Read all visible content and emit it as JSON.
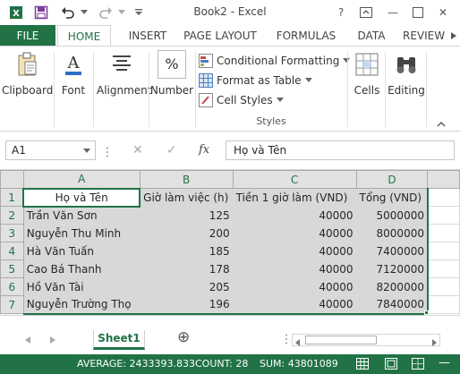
{
  "window": {
    "title": "Book2 - Excel",
    "help": "?",
    "minimize": "—",
    "close": "✕"
  },
  "tabs": [
    "FILE",
    "HOME",
    "INSERT",
    "PAGE LAYOUT",
    "FORMULAS",
    "DATA",
    "REVIEW"
  ],
  "ribbon": {
    "clipboard": "Clipboard",
    "font": "Font",
    "alignment": "Alignment",
    "number": "Number",
    "conditional": "Conditional Formatting",
    "format_table": "Format as Table",
    "cell_styles": "Cell Styles",
    "styles_group": "Styles",
    "cells": "Cells",
    "editing": "Editing",
    "number_symbol": "%"
  },
  "formula_bar": {
    "name_box": "A1",
    "fx": "fx",
    "cancel": "✕",
    "enter": "✓",
    "content": "Họ và Tên"
  },
  "columns": [
    "A",
    "B",
    "C",
    "D"
  ],
  "rows": [
    {
      "num": "1",
      "a": "Họ và Tên",
      "b": "Giờ làm việc (h)",
      "c": "Tiền 1 giờ làm (VND)",
      "d": "Tổng (VND)"
    },
    {
      "num": "2",
      "a": "Trần Văn Sơn",
      "b": "125",
      "c": "40000",
      "d": "5000000"
    },
    {
      "num": "3",
      "a": "Nguyễn Thu Minh",
      "b": "200",
      "c": "40000",
      "d": "8000000"
    },
    {
      "num": "4",
      "a": "Hà Văn Tuấn",
      "b": "185",
      "c": "40000",
      "d": "7400000"
    },
    {
      "num": "5",
      "a": "Cao Bá Thanh",
      "b": "178",
      "c": "40000",
      "d": "7120000"
    },
    {
      "num": "6",
      "a": "Hồ Văn Tài",
      "b": "205",
      "c": "40000",
      "d": "8200000"
    },
    {
      "num": "7",
      "a": "Nguyễn Trường Thọ",
      "b": "196",
      "c": "40000",
      "d": "7840000"
    }
  ],
  "sheet": {
    "name": "Sheet1",
    "add": "⊕"
  },
  "status": {
    "average": "AVERAGE: 2433393.833",
    "count": "COUNT: 28",
    "sum": "SUM: 43801089"
  },
  "colors": {
    "accent": "#217346",
    "selection": "#d8d8d8"
  }
}
